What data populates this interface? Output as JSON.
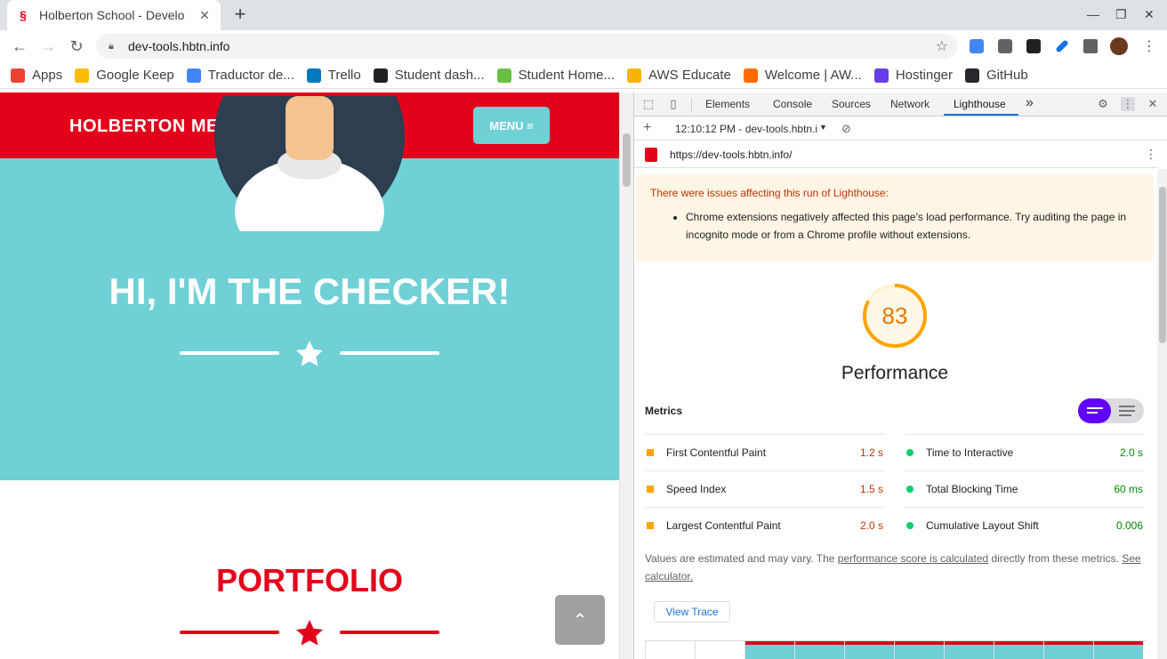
{
  "browser": {
    "tab_title": "Holberton School - Develo",
    "url": "dev-tools.hbtn.info",
    "bookmarks": [
      {
        "label": "Apps",
        "color": "#ea4335"
      },
      {
        "label": "Google Keep",
        "color": "#fbbc04"
      },
      {
        "label": "Traductor de...",
        "color": "#4285f4"
      },
      {
        "label": "Trello",
        "color": "#0079bf"
      },
      {
        "label": "Student dash...",
        "color": "#202124"
      },
      {
        "label": "Student Home...",
        "color": "#6ac045"
      },
      {
        "label": "AWS Educate",
        "color": "#f7b500"
      },
      {
        "label": "Welcome | AW...",
        "color": "#ff6a00"
      },
      {
        "label": "Hostinger",
        "color": "#673de6"
      },
      {
        "label": "GitHub",
        "color": "#24292e"
      }
    ]
  },
  "site": {
    "brand": "HOLBERTON ME",
    "menu_label": "MENU ≡",
    "hero_title": "HI, I'M THE CHECKER!",
    "portfolio_title": "PORTFOLIO",
    "back_to_top": "⌃"
  },
  "devtools": {
    "tabs": [
      "Elements",
      "Console",
      "Sources",
      "Network",
      "Lighthouse"
    ],
    "more": "»",
    "report_time": "12:10:12 PM - dev-tools.hbtn.i",
    "report_url": "https://dev-tools.hbtn.info/",
    "warning_title": "There were issues affecting this run of Lighthouse:",
    "warning_item": "Chrome extensions negatively affected this page's load performance. Try auditing the page in incognito mode or from a Chrome profile without extensions.",
    "score": "83",
    "score_fraction": 0.83,
    "category": "Performance",
    "metrics_heading": "Metrics",
    "metrics_left": [
      {
        "label": "First Contentful Paint",
        "value": "1.2 s",
        "status": "average"
      },
      {
        "label": "Speed Index",
        "value": "1.5 s",
        "status": "average"
      },
      {
        "label": "Largest Contentful Paint",
        "value": "2.0 s",
        "status": "average"
      }
    ],
    "metrics_right": [
      {
        "label": "Time to Interactive",
        "value": "2.0 s",
        "status": "pass"
      },
      {
        "label": "Total Blocking Time",
        "value": "60 ms",
        "status": "pass"
      },
      {
        "label": "Cumulative Layout Shift",
        "value": "0.006",
        "status": "pass"
      }
    ],
    "note_prefix": "Values are estimated and may vary. The ",
    "note_link": "performance score is calculated",
    "note_mid": " directly from these metrics. ",
    "note_link2": "See calculator.",
    "view_trace": "View Trace"
  },
  "colors": {
    "brand_red": "#e2001a",
    "hero_teal": "#6fd0d6",
    "average": "#e67700",
    "average_square": "#ffa400",
    "pass": "#008800",
    "pass_dot": "#0cce6b"
  }
}
